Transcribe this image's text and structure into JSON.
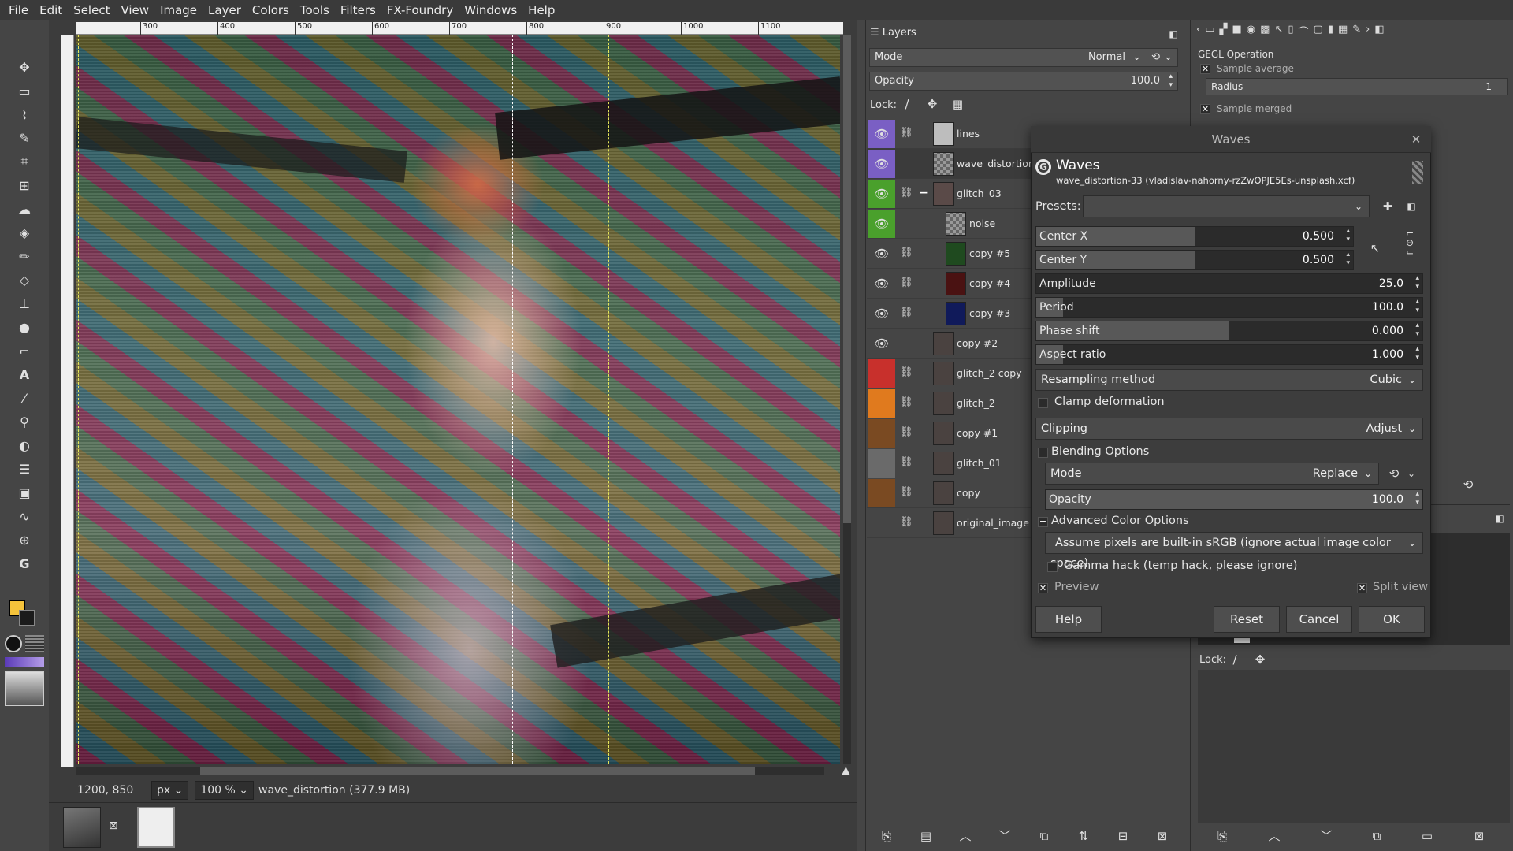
{
  "menubar": [
    "File",
    "Edit",
    "Select",
    "View",
    "Image",
    "Layer",
    "Colors",
    "Tools",
    "Filters",
    "FX-Foundry",
    "Windows",
    "Help"
  ],
  "ruler": {
    "ticks": [
      "300",
      "400",
      "500",
      "600",
      "700",
      "800",
      "900",
      "1000",
      "1100"
    ]
  },
  "status": {
    "coords": "1200, 850",
    "unit": "px",
    "zoom": "100 %",
    "layer_info": "wave_distortion (377.9 MB)"
  },
  "colors": {
    "fg": "#f5c33b",
    "bg": "#1b1b1b",
    "accent_selected": "#5a5a8a",
    "guide_yellow": "#e6e65a",
    "guide_white": "#ffffff"
  },
  "layers_panel": {
    "title": "Layers",
    "mode_label": "Mode",
    "mode_value": "Normal",
    "opacity_label": "Opacity",
    "opacity_value": "100.0",
    "lock_label": "Lock:",
    "layers": [
      {
        "name": "lines",
        "visible": true,
        "chain": true,
        "tag": "#7a5fc4"
      },
      {
        "name": "wave_distortion",
        "visible": true,
        "chain": false,
        "tag": "#7a5fc4",
        "selected": true
      },
      {
        "name": "glitch_03",
        "visible": true,
        "chain": true,
        "tag": "#4aa02c",
        "group": true
      },
      {
        "name": "noise",
        "visible": true,
        "chain": false,
        "tag": "#4aa02c"
      },
      {
        "name": "copy #5",
        "visible": true,
        "chain": true,
        "tag": ""
      },
      {
        "name": "copy #4",
        "visible": true,
        "chain": true,
        "tag": ""
      },
      {
        "name": "copy #3",
        "visible": true,
        "chain": true,
        "tag": ""
      },
      {
        "name": "copy #2",
        "visible": true,
        "chain": false,
        "tag": ""
      },
      {
        "name": "glitch_2 copy",
        "visible": false,
        "chain": true,
        "tag": "#c8302c"
      },
      {
        "name": "glitch_2",
        "visible": false,
        "chain": true,
        "tag": "#e07a1e"
      },
      {
        "name": "copy #1",
        "visible": false,
        "chain": true,
        "tag": "#7a4a22"
      },
      {
        "name": "glitch_01",
        "visible": false,
        "chain": true,
        "tag": "#6a6a6a"
      },
      {
        "name": "copy",
        "visible": false,
        "chain": true,
        "tag": "#7a4a22"
      },
      {
        "name": "original_image",
        "visible": false,
        "chain": true,
        "tag": ""
      }
    ]
  },
  "gegl": {
    "title": "GEGL Operation",
    "sample_average": "Sample average",
    "radius_label": "Radius",
    "radius_value": "1",
    "sample_merged": "Sample merged"
  },
  "dialog": {
    "window_title": "Waves",
    "heading": "Waves",
    "subtitle": "wave_distortion-33 (vladislav-nahorny-rzZwOPJE5Es-unsplash.xcf)",
    "presets_label": "Presets:",
    "sliders": [
      {
        "label": "Center X",
        "value": "0.500",
        "fraction": 0.5
      },
      {
        "label": "Center Y",
        "value": "0.500",
        "fraction": 0.5
      },
      {
        "label": "Amplitude",
        "value": "25.0",
        "fraction": 0.0
      },
      {
        "label": "Period",
        "value": "100.0",
        "fraction": 0.07
      },
      {
        "label": "Phase shift",
        "value": "0.000",
        "fraction": 0.5
      },
      {
        "label": "Aspect ratio",
        "value": "1.000",
        "fraction": 0.07
      }
    ],
    "resampling_label": "Resampling method",
    "resampling_value": "Cubic",
    "clamp_label": "Clamp deformation",
    "clipping_label": "Clipping",
    "clipping_value": "Adjust",
    "blending_heading": "Blending Options",
    "blend_mode_label": "Mode",
    "blend_mode_value": "Replace",
    "blend_opacity_label": "Opacity",
    "blend_opacity_value": "100.0",
    "advanced_heading": "Advanced Color Options",
    "advanced_combo": "Assume pixels are built-in sRGB (ignore actual image color space)",
    "gamma_label": "Gamma hack (temp hack, please ignore)",
    "preview_label": "Preview",
    "split_label": "Split view",
    "buttons": {
      "help": "Help",
      "reset": "Reset",
      "cancel": "Cancel",
      "ok": "OK"
    }
  },
  "right_dock": {
    "lock_label": "Lock:"
  }
}
